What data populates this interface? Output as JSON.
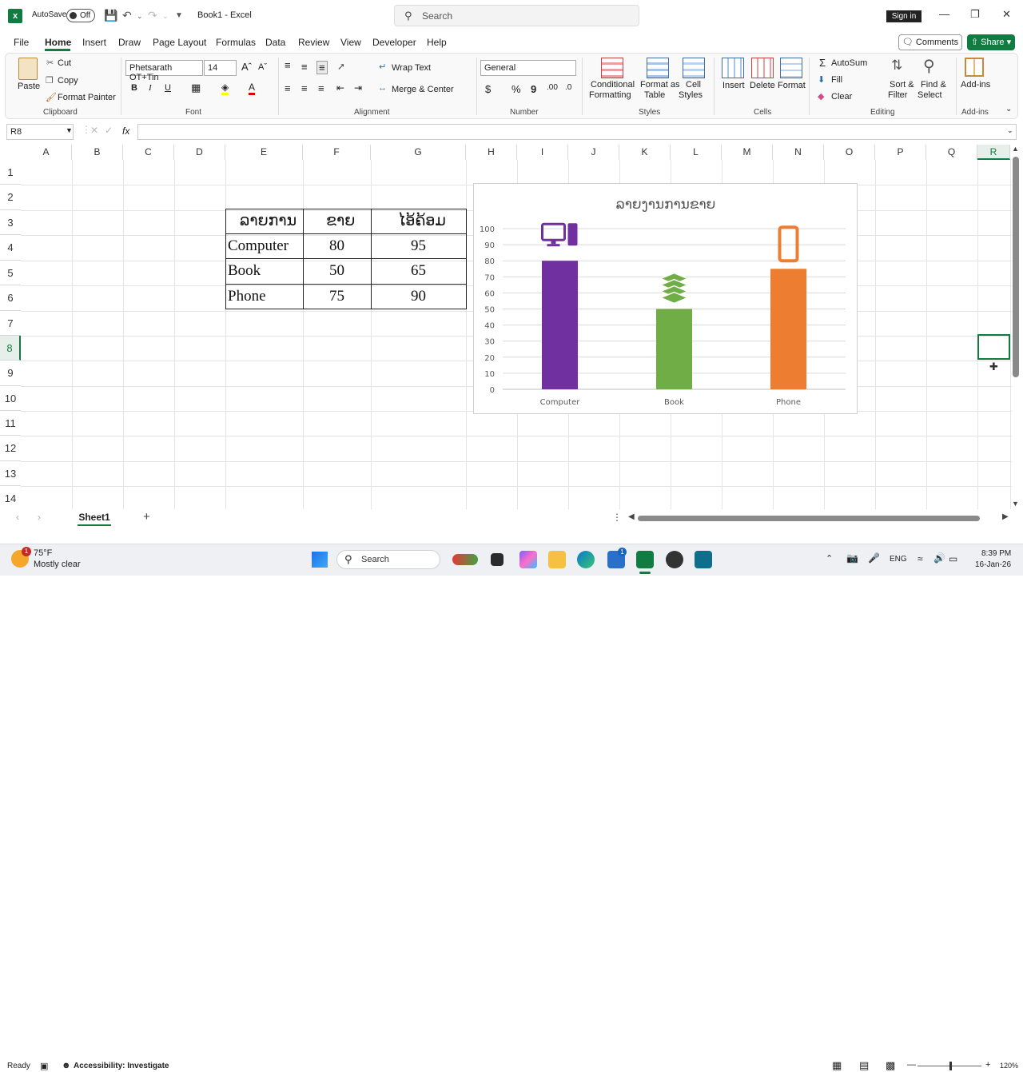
{
  "titlebar": {
    "autosave_label": "AutoSave",
    "autosave_state": "Off",
    "doc_title": "Book1  -  Excel",
    "search_placeholder": "Search",
    "signin_label": "Sign in"
  },
  "menu": {
    "tabs": [
      "File",
      "Home",
      "Insert",
      "Draw",
      "Page Layout",
      "Formulas",
      "Data",
      "Review",
      "View",
      "Developer",
      "Help"
    ],
    "active": "Home",
    "comments_label": "Comments",
    "share_label": "Share"
  },
  "ribbon": {
    "clipboard": {
      "paste": "Paste",
      "cut": "Cut",
      "copy": "Copy",
      "format_painter": "Format Painter",
      "group": "Clipboard"
    },
    "font": {
      "name": "Phetsarath OT+Tin",
      "size": "14",
      "bold": "B",
      "italic": "I",
      "underline": "U",
      "group": "Font"
    },
    "alignment": {
      "wrap_text": "Wrap Text",
      "merge_center": "Merge & Center",
      "group": "Alignment"
    },
    "number": {
      "format": "General",
      "currency": "$",
      "percent": "%",
      "comma": "9",
      "group": "Number"
    },
    "styles": {
      "conditional_1": "Conditional",
      "conditional_2": "Formatting",
      "format_table_1": "Format as",
      "format_table_2": "Table",
      "cell_styles_1": "Cell",
      "cell_styles_2": "Styles",
      "group": "Styles"
    },
    "cells": {
      "insert": "Insert",
      "delete": "Delete",
      "format": "Format",
      "group": "Cells"
    },
    "editing": {
      "autosum": "AutoSum",
      "fill": "Fill",
      "clear": "Clear",
      "sort_1": "Sort &",
      "sort_2": "Filter",
      "find_1": "Find &",
      "find_2": "Select",
      "group": "Editing"
    },
    "addins": {
      "label": "Add-ins",
      "group": "Add-ins"
    }
  },
  "formula_bar": {
    "name_box": "R8",
    "fx": "fx",
    "value": ""
  },
  "grid": {
    "columns": [
      "A",
      "B",
      "C",
      "D",
      "E",
      "F",
      "G",
      "H",
      "I",
      "J",
      "K",
      "L",
      "M",
      "N",
      "O",
      "P",
      "Q",
      "R"
    ],
    "rows": [
      "1",
      "2",
      "3",
      "4",
      "5",
      "6",
      "7",
      "8",
      "9",
      "10",
      "11",
      "12",
      "13",
      "14"
    ],
    "selected_cell": "R8"
  },
  "table": {
    "headers": [
      "ລາຍການ",
      "ຂາຍ",
      "ໄອ້ຄ້ອມ"
    ],
    "rows": [
      [
        "Computer",
        "80",
        "95"
      ],
      [
        "Book",
        "50",
        "65"
      ],
      [
        "Phone",
        "75",
        "90"
      ]
    ]
  },
  "chart_data": {
    "type": "bar",
    "title": "ລາຍງານການຂາຍ",
    "categories": [
      "Computer",
      "Book",
      "Phone"
    ],
    "values": [
      80,
      50,
      75
    ],
    "colors": [
      "#7030a0",
      "#70ad47",
      "#ed7d31"
    ],
    "icons": [
      "computer-icon",
      "books-icon",
      "phone-icon"
    ],
    "ylim": [
      0,
      100
    ],
    "yticks": [
      "0",
      "10",
      "20",
      "30",
      "40",
      "50",
      "60",
      "70",
      "80",
      "90",
      "100"
    ],
    "grid": true
  },
  "sheets": {
    "tabs": [
      "Sheet1"
    ],
    "active": "Sheet1"
  },
  "status": {
    "ready": "Ready",
    "accessibility": "Accessibility: Investigate",
    "zoom": "120%"
  },
  "taskbar": {
    "weather_temp": "75°F",
    "weather_desc": "Mostly clear",
    "weather_badge": "1",
    "search": "Search",
    "store_badge": "1",
    "lang": "ENG",
    "time": "8:39 PM",
    "date": "16-Jan-26"
  }
}
